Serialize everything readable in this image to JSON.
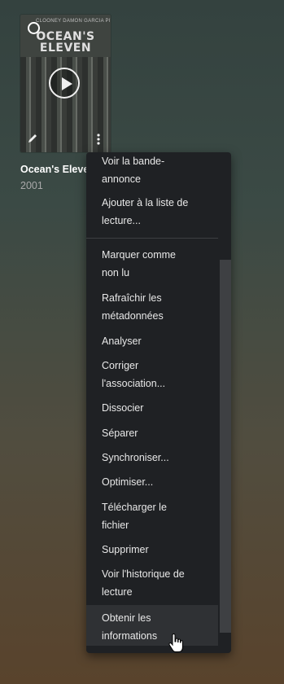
{
  "card": {
    "poster_cast_text": "CLOONEY DAMON GARCIA PITT ROBERTS",
    "poster_title_line1": "OCEAN'S",
    "poster_title_line2": "ELEVEN",
    "title": "Ocean's Eleve",
    "year": "2001"
  },
  "icons": {
    "select": "circle-select-icon",
    "play": "play-icon",
    "edit": "pencil-icon",
    "more": "vertical-ellipsis-icon",
    "cursor": "hand-pointer-icon"
  },
  "menu": {
    "items": [
      {
        "line1": "Voir la bande-",
        "line2": "annonce"
      },
      {
        "line1": "Ajouter à la liste de",
        "line2": "lecture..."
      },
      {
        "line1": "Marquer comme",
        "line2": "non lu"
      },
      {
        "line1": "Rafraîchir les",
        "line2": "métadonnées"
      },
      {
        "line1": "Analyser",
        "line2": ""
      },
      {
        "line1": "Corriger",
        "line2": "l'association..."
      },
      {
        "line1": "Dissocier",
        "line2": ""
      },
      {
        "line1": "Séparer",
        "line2": ""
      },
      {
        "line1": "Synchroniser...",
        "line2": ""
      },
      {
        "line1": "Optimiser...",
        "line2": ""
      },
      {
        "line1": "Télécharger le",
        "line2": "fichier"
      },
      {
        "line1": "Supprimer",
        "line2": ""
      },
      {
        "line1": "Voir l'historique de",
        "line2": "lecture"
      },
      {
        "line1": "Obtenir les",
        "line2": "informations"
      }
    ],
    "hovered_item": "Obtenir les informations"
  },
  "colors": {
    "menu_bg": "#1f2124",
    "menu_hover": "#2f3134",
    "text": "#e8e8e8",
    "muted": "#a9a9a9"
  }
}
